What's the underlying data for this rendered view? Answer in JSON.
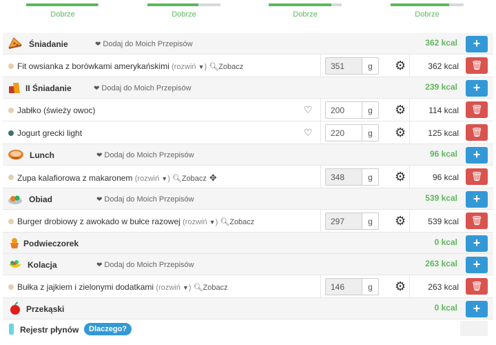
{
  "progress": [
    {
      "label": "Dobrze",
      "fill": 0.98
    },
    {
      "label": "Dobrze",
      "fill": 0.7
    },
    {
      "label": "Dobrze",
      "fill": 0.86
    },
    {
      "label": "Dobrze",
      "fill": 0.8
    }
  ],
  "common": {
    "fav_label": "Dodaj do Moich Przepisów",
    "expand_label": "(rozwiń",
    "view_label": "Zobacz",
    "unit": "g",
    "add_symbol": "+",
    "delete_icon": "trash-icon",
    "settings_icon": "gear-icon"
  },
  "colors": {
    "accent_blue": "#3399d6",
    "green": "#5cb85c",
    "danger": "#d9534f"
  },
  "meals": [
    {
      "name": "Śniadanie",
      "kcal": "362 kcal",
      "icon": "pizza-icon",
      "has_fav": true,
      "items": [
        {
          "name": "Fit owsianka z borówkami amerykańskimi",
          "expandable": true,
          "view": true,
          "qty": "351",
          "qty_editable": false,
          "kcal": "362 kcal",
          "dot": "light"
        }
      ]
    },
    {
      "name": "II Śniadanie",
      "kcal": "239 kcal",
      "icon": "sandwich-icon",
      "has_fav": true,
      "items": [
        {
          "name": "Jabłko (świeży owoc)",
          "heart": true,
          "qty": "200",
          "qty_editable": true,
          "kcal": "114 kcal",
          "dot": "light"
        },
        {
          "name": "Jogurt grecki light",
          "heart": true,
          "qty": "220",
          "qty_editable": true,
          "kcal": "125 kcal",
          "dot": "dark"
        }
      ]
    },
    {
      "name": "Lunch",
      "kcal": "96 kcal",
      "icon": "soup-icon",
      "has_fav": true,
      "items": [
        {
          "name": "Zupa kalafiorowa z makaronem",
          "expandable": true,
          "view": true,
          "move": true,
          "qty": "348",
          "qty_editable": false,
          "kcal": "96 kcal",
          "dot": "light"
        }
      ]
    },
    {
      "name": "Obiad",
      "kcal": "539 kcal",
      "icon": "dinner-plate-icon",
      "has_fav": true,
      "items": [
        {
          "name": "Burger drobiowy z awokado w bułce razowej",
          "expandable": true,
          "view": true,
          "qty": "297",
          "qty_editable": false,
          "kcal": "539 kcal",
          "dot": "light"
        }
      ]
    },
    {
      "name": "Podwieczorek",
      "kcal": "0 kcal",
      "icon": "snack-icon",
      "has_fav": false,
      "items": []
    },
    {
      "name": "Kolacja",
      "kcal": "263 kcal",
      "icon": "salad-bowl-icon",
      "has_fav": true,
      "items": [
        {
          "name": "Bułka z jajkiem i zielonymi dodatkami",
          "expandable": true,
          "view": true,
          "qty": "146",
          "qty_editable": false,
          "kcal": "263 kcal",
          "dot": "light"
        }
      ]
    },
    {
      "name": "Przekąski",
      "kcal": "0 kcal",
      "icon": "apple-icon",
      "has_fav": false,
      "items": []
    }
  ],
  "fluids": {
    "label": "Rejestr płynów",
    "why": "Dlaczego?",
    "icon": "water-glass-icon"
  }
}
